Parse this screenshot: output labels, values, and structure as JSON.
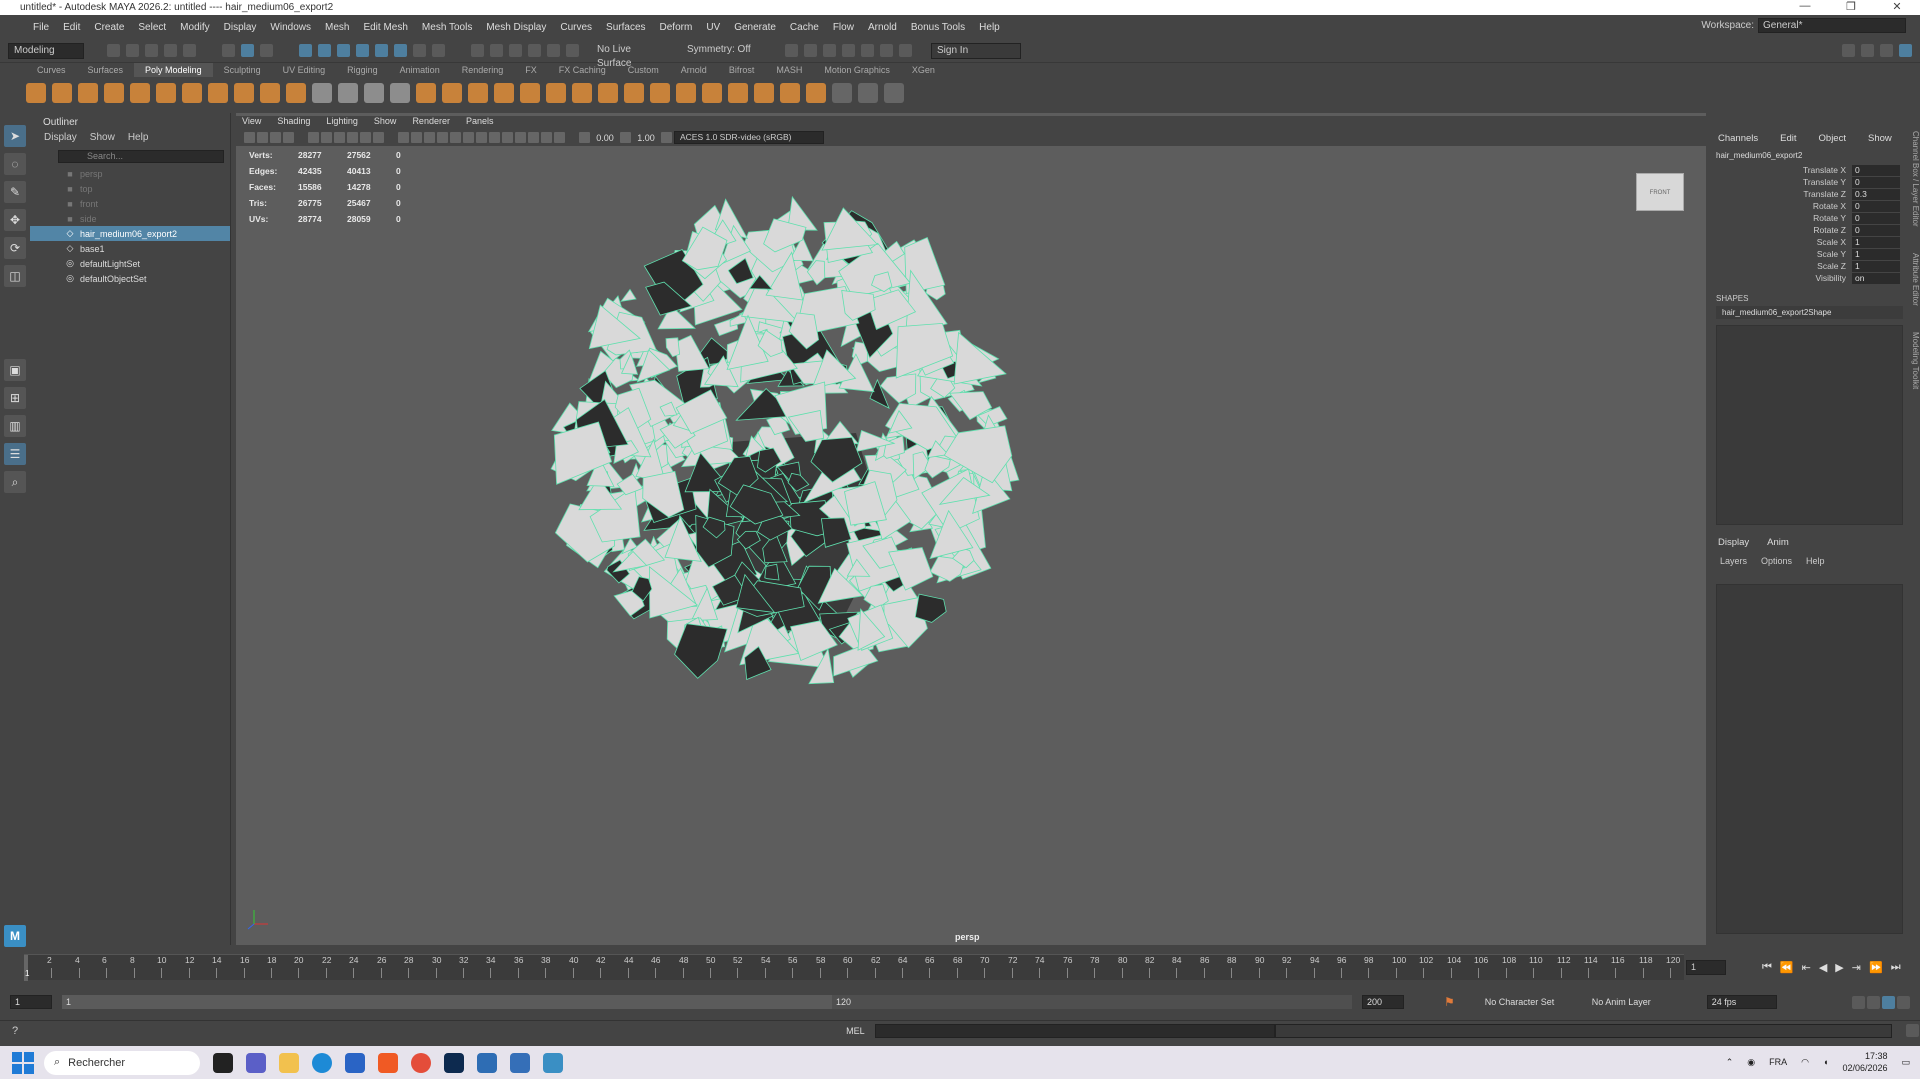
{
  "window": {
    "title": "untitled* - Autodesk MAYA 2026.2: untitled   ----   hair_medium06_export2"
  },
  "menu": [
    "File",
    "Edit",
    "Create",
    "Select",
    "Modify",
    "Display",
    "Windows",
    "Mesh",
    "Edit Mesh",
    "Mesh Tools",
    "Mesh Display",
    "Curves",
    "Surfaces",
    "Deform",
    "UV",
    "Generate",
    "Cache",
    "Flow",
    "Arnold",
    "Bonus Tools",
    "Help"
  ],
  "workspace": {
    "label": "Workspace:",
    "value": "General*"
  },
  "statusline": {
    "mode": "Modeling",
    "live_surface": "No Live Surface",
    "symmetry": "Symmetry: Off",
    "sign_in": "Sign In"
  },
  "shelf_tabs": [
    "Curves",
    "Surfaces",
    "Poly Modeling",
    "Sculpting",
    "UV Editing",
    "Rigging",
    "Animation",
    "Rendering",
    "FX",
    "FX Caching",
    "Custom",
    "Arnold",
    "Bifrost",
    "MASH",
    "Motion Graphics",
    "XGen"
  ],
  "outliner": {
    "title": "Outliner",
    "menu": [
      "Display",
      "Show",
      "Help"
    ],
    "search_placeholder": "Search...",
    "items": [
      {
        "name": "persp",
        "icon": "camera-icon",
        "dim": true
      },
      {
        "name": "top",
        "icon": "camera-icon",
        "dim": true
      },
      {
        "name": "front",
        "icon": "camera-icon",
        "dim": true
      },
      {
        "name": "side",
        "icon": "camera-icon",
        "dim": true
      },
      {
        "name": "hair_medium06_export2",
        "icon": "mesh-icon",
        "selected": true
      },
      {
        "name": "base1",
        "icon": "mesh-icon"
      },
      {
        "name": "defaultLightSet",
        "icon": "set-icon"
      },
      {
        "name": "defaultObjectSet",
        "icon": "set-icon"
      }
    ]
  },
  "viewport": {
    "menu": [
      "View",
      "Shading",
      "Lighting",
      "Show",
      "Renderer",
      "Panels"
    ],
    "field1": "0.00",
    "field2": "1.00",
    "colorspace": "ACES 1.0 SDR-video (sRGB)",
    "camera": "persp",
    "viewcube": "FRONT",
    "hud": [
      {
        "label": "Verts:",
        "a": "28277",
        "b": "27562",
        "c": "0"
      },
      {
        "label": "Edges:",
        "a": "42435",
        "b": "40413",
        "c": "0"
      },
      {
        "label": "Faces:",
        "a": "15586",
        "b": "14278",
        "c": "0"
      },
      {
        "label": "Tris:",
        "a": "26775",
        "b": "25467",
        "c": "0"
      },
      {
        "label": "UVs:",
        "a": "28774",
        "b": "28059",
        "c": "0"
      }
    ]
  },
  "channelbox": {
    "tabs": [
      "Channels",
      "Edit",
      "Object",
      "Show"
    ],
    "object": "hair_medium06_export2",
    "attrs": [
      {
        "name": "Translate X",
        "value": "0"
      },
      {
        "name": "Translate Y",
        "value": "0"
      },
      {
        "name": "Translate Z",
        "value": "0.3"
      },
      {
        "name": "Rotate X",
        "value": "0"
      },
      {
        "name": "Rotate Y",
        "value": "0"
      },
      {
        "name": "Rotate Z",
        "value": "0"
      },
      {
        "name": "Scale X",
        "value": "1"
      },
      {
        "name": "Scale Y",
        "value": "1"
      },
      {
        "name": "Scale Z",
        "value": "1"
      },
      {
        "name": "Visibility",
        "value": "on"
      }
    ],
    "shapes_label": "SHAPES",
    "shape": "hair_medium06_export2Shape"
  },
  "layers": {
    "tabs": [
      "Display",
      "Anim"
    ],
    "menu": [
      "Layers",
      "Options",
      "Help"
    ]
  },
  "side_tabs": [
    "Channel Box / Layer Editor",
    "Attribute Editor",
    "Modeling Toolkit"
  ],
  "timeline": {
    "ticks": [
      "2",
      "4",
      "6",
      "8",
      "10",
      "12",
      "14",
      "16",
      "18",
      "20",
      "22",
      "24",
      "26",
      "28",
      "30",
      "32",
      "34",
      "36",
      "38",
      "40",
      "42",
      "44",
      "46",
      "48",
      "50",
      "52",
      "54",
      "56",
      "58",
      "60",
      "62",
      "64",
      "66",
      "68",
      "70",
      "72",
      "74",
      "76",
      "78",
      "80",
      "82",
      "84",
      "86",
      "88",
      "90",
      "92",
      "94",
      "96",
      "98",
      "100",
      "102",
      "104",
      "106",
      "108",
      "110",
      "112",
      "114",
      "116",
      "118",
      "120"
    ],
    "current_frame": "1",
    "frame_field": "1"
  },
  "range": {
    "start": "1",
    "inner_start": "1",
    "inner_end": "120",
    "end": "200",
    "character_set": "No Character Set",
    "anim_layer": "No Anim Layer",
    "fps": "24 fps"
  },
  "command": {
    "label": "MEL"
  },
  "taskbar": {
    "search": "Rechercher",
    "lang": "FRA",
    "time": "17:38",
    "date": "02/06/2026"
  }
}
